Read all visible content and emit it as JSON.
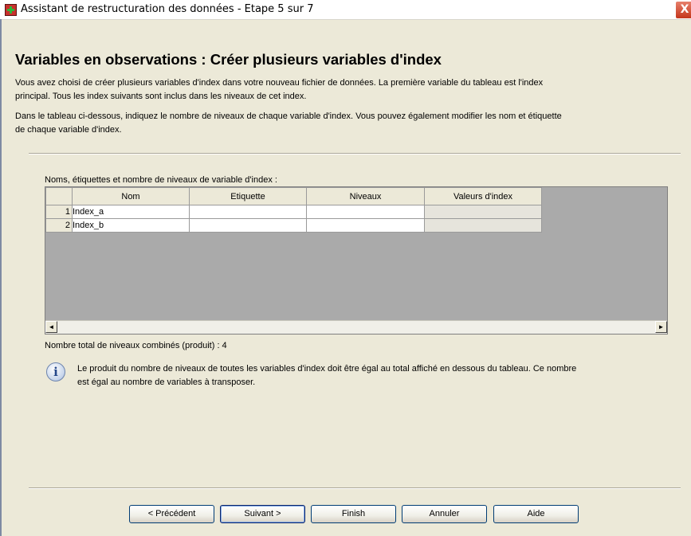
{
  "window": {
    "title": "Assistant de restructuration des données - Etape 5 sur 7",
    "close_glyph": "X"
  },
  "page": {
    "title": "Variables en observations : Créer plusieurs variables d'index",
    "desc1_line1": "Vous avez choisi de créer plusieurs variables d'index dans votre nouveau fichier de données. La première variable du tableau est l'index",
    "desc1_line2": "principal. Tous les index suivants sont inclus dans les niveaux de cet index.",
    "desc2_line1": "Dans le tableau ci-dessous, indiquez le nombre de niveaux de chaque variable d'index. Vous pouvez également modifier les nom et étiquette",
    "desc2_line2": "de chaque variable d'index."
  },
  "table": {
    "label": "Noms, étiquettes et nombre de niveaux de variable d'index :",
    "columns": [
      "Nom",
      "Etiquette",
      "Niveaux",
      "Valeurs d'index"
    ],
    "rows": [
      {
        "num": "1",
        "nom": "Index_a",
        "etiquette": "",
        "niveaux": "",
        "valeurs": ""
      },
      {
        "num": "2",
        "nom": "Index_b",
        "etiquette": "",
        "niveaux": "",
        "valeurs": ""
      }
    ]
  },
  "scroll": {
    "left_glyph": "◄",
    "right_glyph": "►"
  },
  "total": "Nombre total de niveaux combinés (produit) :  4",
  "info": {
    "line1": "Le produit du nombre de niveaux de toutes les variables d'index doit être égal au total affiché en dessous du tableau. Ce nombre",
    "line2": "est égal au nombre de variables à transposer."
  },
  "buttons": {
    "previous": "< Précédent",
    "next": "Suivant >",
    "finish": "Finish",
    "cancel": "Annuler",
    "help": "Aide"
  },
  "icons": {
    "app": "spss-restructure-icon",
    "info": "info-icon"
  }
}
